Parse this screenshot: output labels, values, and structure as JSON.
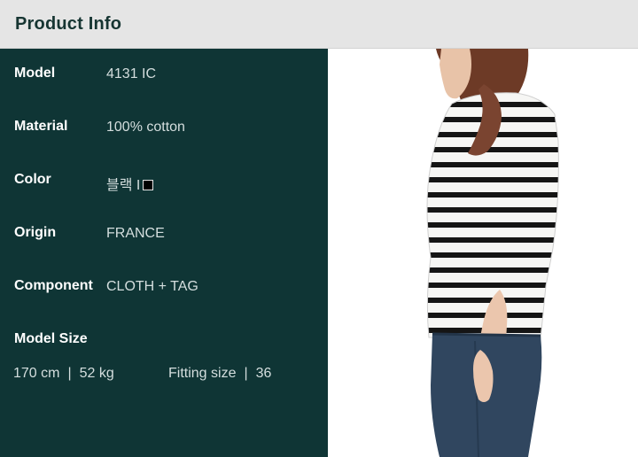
{
  "header": {
    "title": "Product Info"
  },
  "specs": [
    {
      "label": "Model",
      "value": "4131 IC"
    },
    {
      "label": "Material",
      "value": "100% cotton"
    },
    {
      "label": "Color",
      "value": "블랙 I"
    },
    {
      "label": "Origin",
      "value": "FRANCE"
    },
    {
      "label": "Component",
      "value": "CLOTH + TAG"
    }
  ],
  "model_size": {
    "label": "Model Size",
    "height": "170 cm",
    "weight": "52 kg",
    "fitting_label": "Fitting size",
    "fitting_value": "36",
    "separator": "|"
  },
  "colors": {
    "panel": "#0f3535",
    "header": "#e5e5e5",
    "header_text": "#163532",
    "swatch": "#000000"
  }
}
